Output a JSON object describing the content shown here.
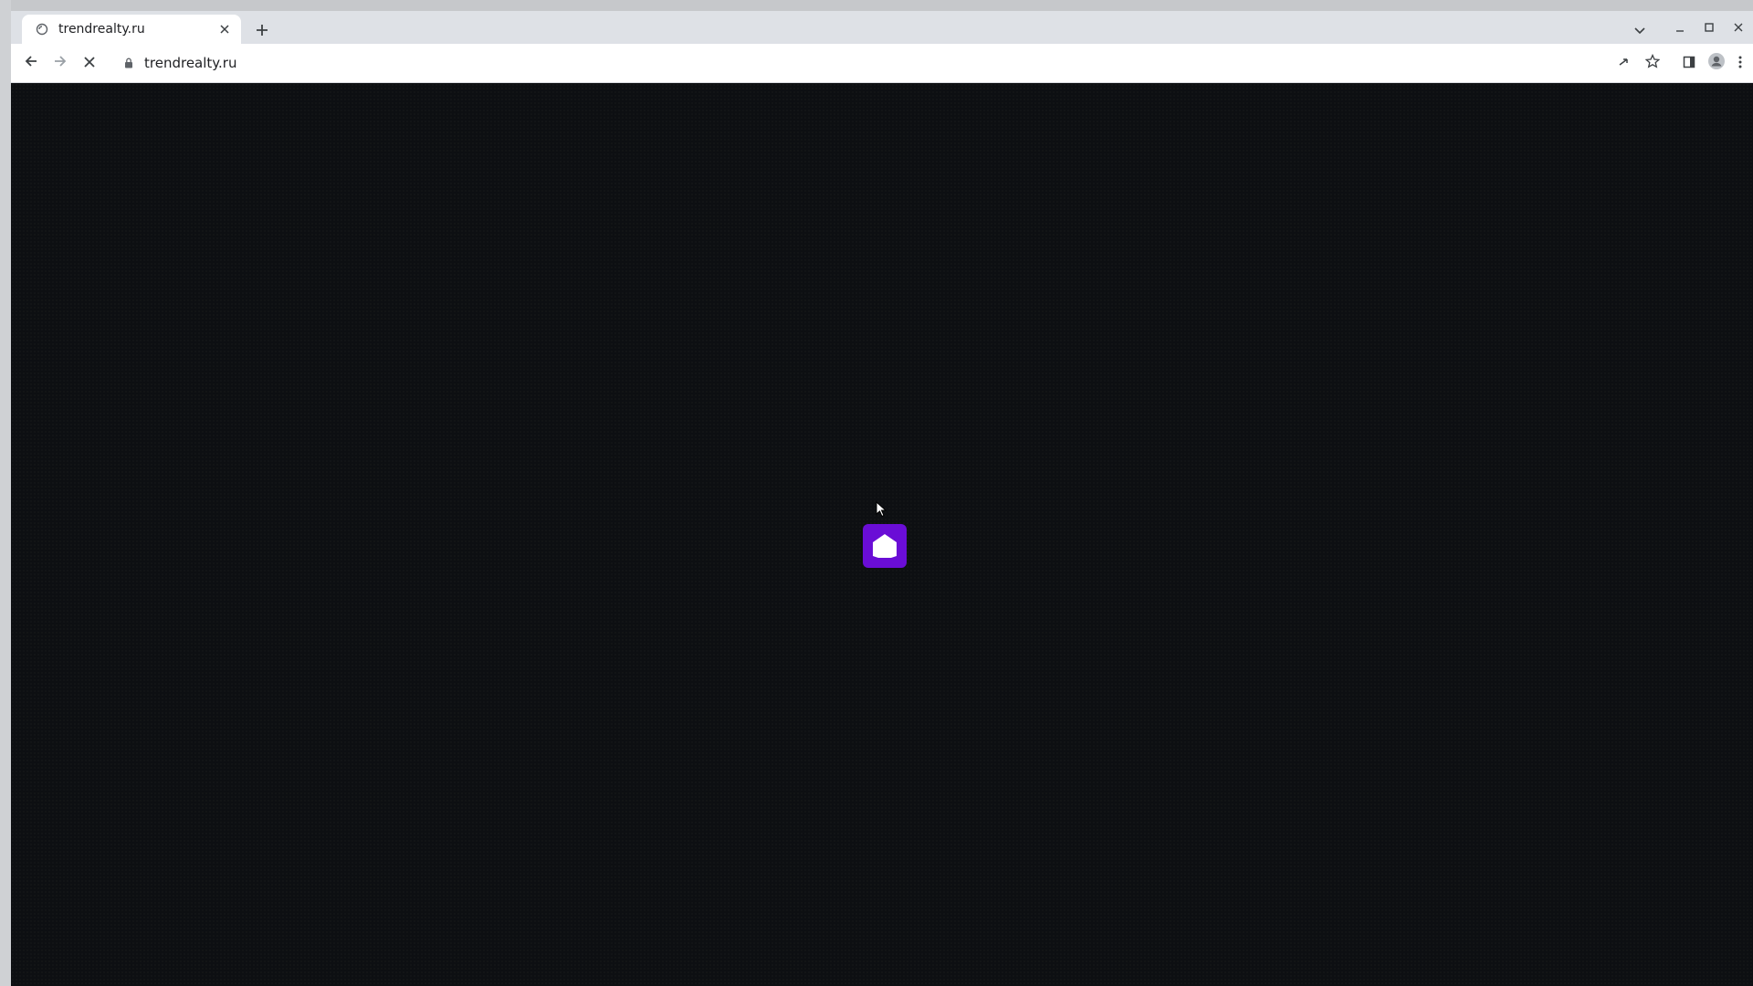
{
  "browser": {
    "tab": {
      "title": "trendrealty.ru",
      "favicon_icon": "loading-globe-icon",
      "close_icon": "close-icon"
    },
    "new_tab_icon": "plus-icon",
    "tab_search_icon": "chevron-down-icon",
    "window_controls": [
      "minimize-icon",
      "maximize-icon",
      "close-icon"
    ],
    "toolbar": {
      "back_icon": "arrow-left-icon",
      "forward_icon": "arrow-right-icon",
      "stop_icon": "stop-x-icon",
      "address": {
        "secure_icon": "lock-icon",
        "url": "trendrealty.ru"
      },
      "right_icons": [
        "share-icon",
        "star-icon",
        "side-panel-icon",
        "profile-icon",
        "menu-kebab-icon"
      ]
    }
  },
  "page": {
    "background_color": "#0d0f12",
    "loader": {
      "icon": "house-logo-icon",
      "color": "#6a0dd6"
    }
  }
}
